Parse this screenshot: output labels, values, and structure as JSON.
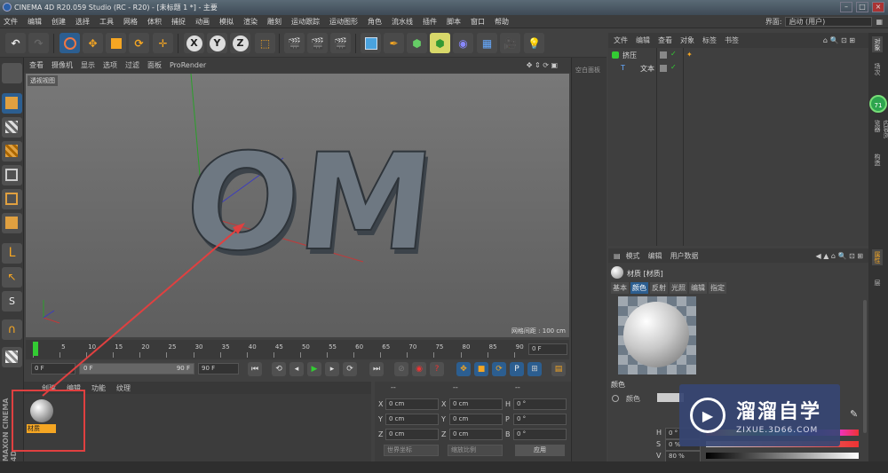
{
  "window": {
    "title": "CINEMA 4D R20.059 Studio (RC - R20) - [未标题 1 *] - 主要"
  },
  "menubar": {
    "items": [
      "文件",
      "编辑",
      "创建",
      "选择",
      "工具",
      "网格",
      "体积",
      "捕捉",
      "动画",
      "模拟",
      "渲染",
      "雕刻",
      "运动跟踪",
      "运动图形",
      "角色",
      "流水线",
      "插件",
      "脚本",
      "窗口",
      "帮助"
    ]
  },
  "layout": {
    "label": "界面:",
    "value": "启动 (用户)"
  },
  "toolbar": {
    "axis_x": "X",
    "axis_y": "Y",
    "axis_z": "Z"
  },
  "viewport": {
    "menu": [
      "查看",
      "摄像机",
      "显示",
      "选项",
      "过滤",
      "面板",
      "ProRender"
    ],
    "label": "透视视图",
    "grid_info": "网格间距 : 100 cm",
    "scene_text": "OM"
  },
  "timeline": {
    "ticks": [
      "0",
      "5",
      "10",
      "15",
      "20",
      "25",
      "30",
      "35",
      "40",
      "45",
      "50",
      "55",
      "60",
      "65",
      "70",
      "75",
      "80",
      "85",
      "90"
    ],
    "frame_field": "0 F"
  },
  "transport": {
    "start": "0 F",
    "range_start": "0 F",
    "range_end": "90 F",
    "end": "90 F"
  },
  "material_panel": {
    "tabs": [
      "创建",
      "编辑",
      "功能",
      "纹理"
    ],
    "material_name": "材质",
    "brand": "MAXON CINEMA 4D"
  },
  "coords": {
    "headers": [
      "--",
      "--",
      "--"
    ],
    "rows": [
      [
        "X",
        "0 cm",
        "X",
        "0 cm",
        "H",
        "0 °"
      ],
      [
        "Y",
        "0 cm",
        "Y",
        "0 cm",
        "P",
        "0 °"
      ],
      [
        "Z",
        "0 cm",
        "Z",
        "0 cm",
        "B",
        "0 °"
      ]
    ],
    "mode1": "世界坐标",
    "mode2": "缩放比例",
    "apply": "应用"
  },
  "right_strip": {
    "label": "空白面板"
  },
  "object_manager": {
    "menu": [
      "文件",
      "编辑",
      "查看",
      "对象",
      "标签",
      "书签"
    ],
    "objects": [
      {
        "name": "挤压"
      },
      {
        "name": "文本"
      }
    ]
  },
  "attribute_manager": {
    "menu": [
      "模式",
      "编辑",
      "用户数据"
    ],
    "title": "材质 [材质]",
    "tabs": [
      "基本",
      "颜色",
      "反射",
      "光照",
      "编辑",
      "指定"
    ],
    "section": "颜色",
    "color_label": "颜色",
    "hsv": [
      {
        "label": "H",
        "value": "0 °"
      },
      {
        "label": "S",
        "value": "0 %"
      },
      {
        "label": "V",
        "value": "80 %"
      }
    ]
  },
  "vtabs": [
    "对象",
    "场次",
    "内容浏览器",
    "构造",
    "属性",
    "层"
  ],
  "perf_badge": "71",
  "watermark": {
    "title": "溜溜自学",
    "url": "ZIXUE.3D66.COM"
  }
}
